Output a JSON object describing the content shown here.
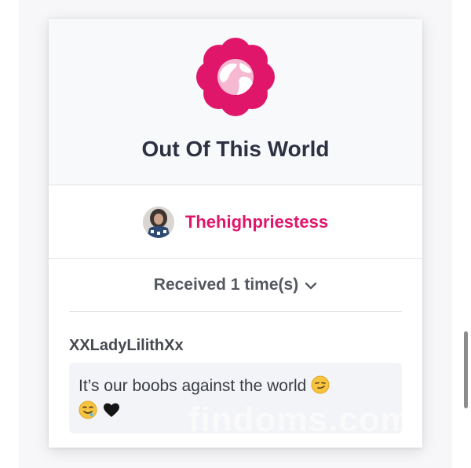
{
  "badge": {
    "title": "Out Of This World",
    "icon": "globe-flower-icon",
    "color": "#e0166b"
  },
  "sender": {
    "name": "Thehighpriestess",
    "avatar": "avatar-photo"
  },
  "received": {
    "label": "Received 1 time(s)"
  },
  "comment": {
    "author": "XXLadyLilithXx",
    "text": "It’s our boobs against the world",
    "emojis": [
      "smirking-face-emoji",
      "drooling-face-emoji",
      "black-heart-emoji"
    ]
  },
  "watermark": "findoms.com"
}
